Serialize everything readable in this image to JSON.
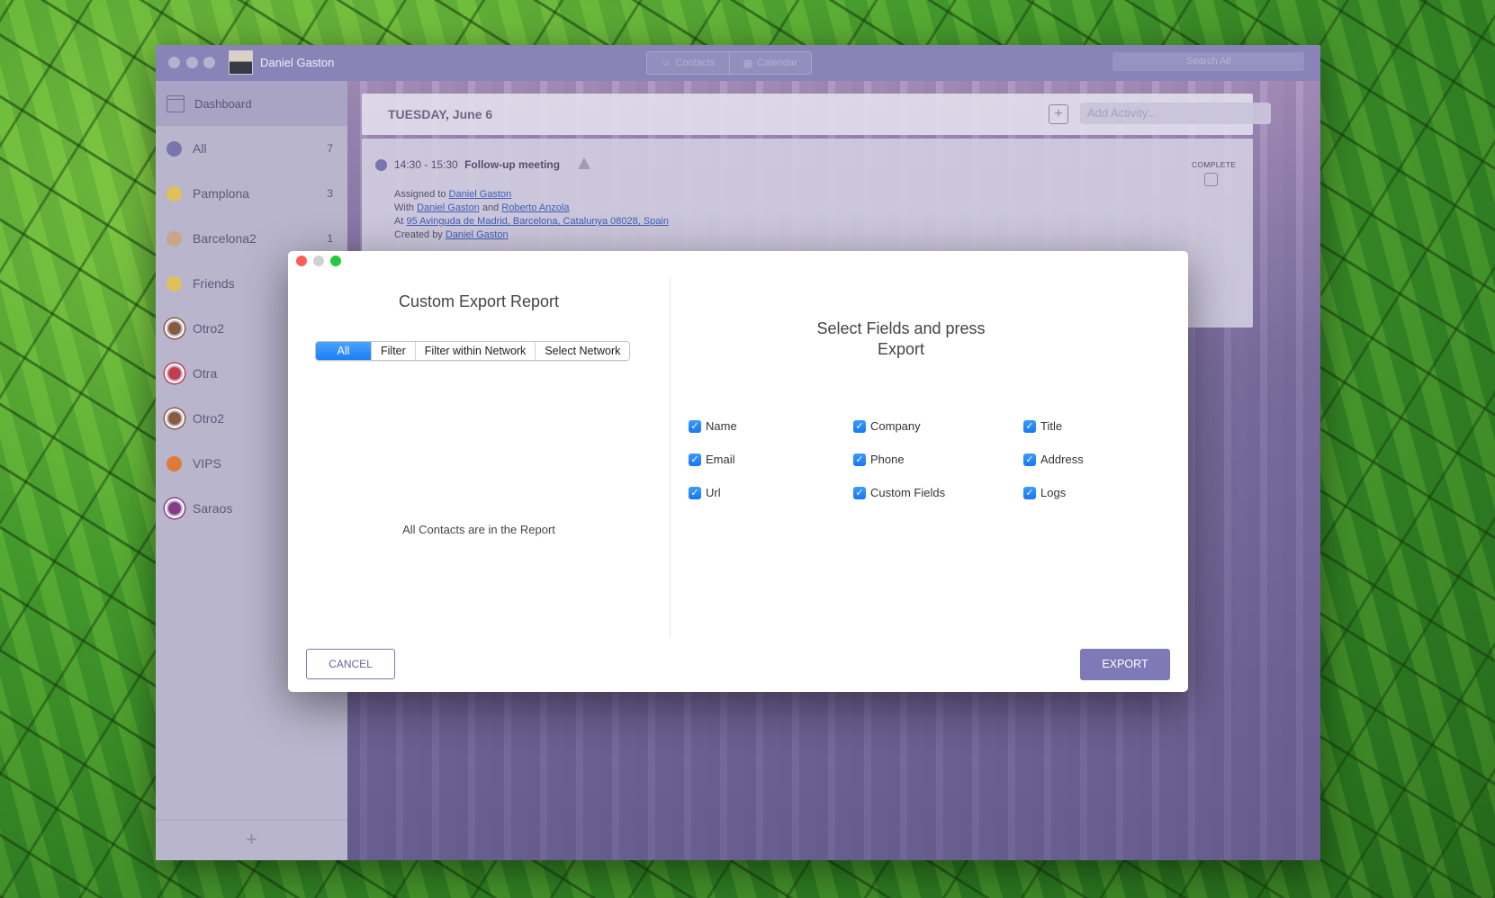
{
  "app": {
    "user_name": "Daniel Gaston",
    "tabs": {
      "contacts": "Contacts",
      "calendar": "Calendar"
    },
    "search_placeholder": "Search All"
  },
  "sidebar": {
    "dashboard_label": "Dashboard",
    "items": [
      {
        "label": "All",
        "count": "7",
        "color": "#7a74ad"
      },
      {
        "label": "Pamplona",
        "count": "3",
        "color": "#e0c05a"
      },
      {
        "label": "Barcelona2",
        "count": "1",
        "color": "#c9a58a"
      },
      {
        "label": "Friends",
        "count": "",
        "color": "#e0c05a"
      },
      {
        "label": "Otro2",
        "count": "",
        "color": "#8a5a3a"
      },
      {
        "label": "Otra",
        "count": "",
        "color": "#c93a4a"
      },
      {
        "label": "Otro2",
        "count": "",
        "color": "#8a5a3a"
      },
      {
        "label": "VIPS",
        "count": "",
        "color": "#e07a3a"
      },
      {
        "label": "Saraos",
        "count": "",
        "color": "#8a3a8a"
      }
    ],
    "add_label": "+"
  },
  "calendar": {
    "day_title": "TUESDAY, June 6",
    "add_activity_placeholder": "Add Activity...",
    "event": {
      "time": "14:30 - 15:30",
      "title": "Follow-up meeting",
      "assigned_prefix": "Assigned to",
      "assigned_to": "Daniel Gaston",
      "with_prefix": "With",
      "with_1": "Daniel Gaston",
      "with_and": "and",
      "with_2": "Roberto Anzola",
      "at_prefix": "At",
      "address": "95 Avinguda de Madrid, Barcelona, Catalunya 08028, Spain",
      "created_prefix": "Created by",
      "created_by": "Daniel Gaston",
      "complete_label": "COMPLETE"
    }
  },
  "dialog": {
    "left_title": "Custom Export Report",
    "segments": [
      "All",
      "Filter",
      "Filter within Network",
      "Select Network"
    ],
    "active_segment": "All",
    "left_message": "All Contacts are in the Report",
    "right_title_line1": "Select Fields and press",
    "right_title_line2": "Export",
    "fields": [
      {
        "label": "Name",
        "checked": true
      },
      {
        "label": "Company",
        "checked": true
      },
      {
        "label": "Title",
        "checked": true
      },
      {
        "label": "Email",
        "checked": true
      },
      {
        "label": "Phone",
        "checked": true
      },
      {
        "label": "Address",
        "checked": true
      },
      {
        "label": "Url",
        "checked": true
      },
      {
        "label": "Custom Fields",
        "checked": true
      },
      {
        "label": "Logs",
        "checked": true
      }
    ],
    "cancel_label": "CANCEL",
    "export_label": "EXPORT"
  },
  "colors": {
    "accent": "#7f79b8",
    "checkbox": "#1a7ef5",
    "close": "#ff5f57",
    "minimize": "#d0d0d0",
    "zoom": "#28c840"
  }
}
